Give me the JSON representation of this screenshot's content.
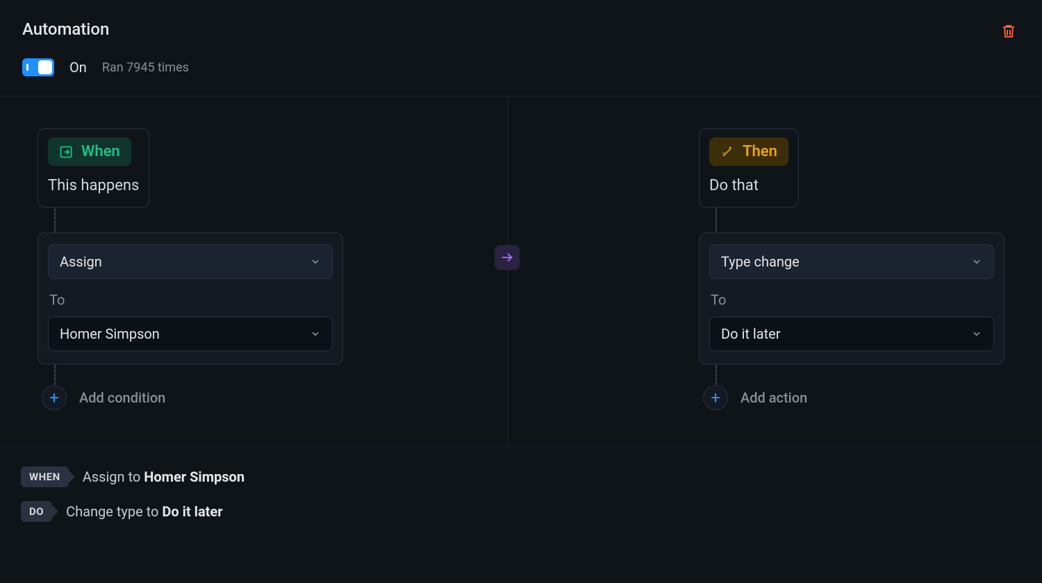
{
  "header": {
    "title": "Automation",
    "toggle_state": "On",
    "run_count_text": "Ran 7945 times"
  },
  "when": {
    "badge": "When",
    "subtitle": "This happens",
    "event_select": "Assign",
    "to_label": "To",
    "to_value": "Homer Simpson",
    "add_label": "Add condition"
  },
  "then": {
    "badge": "Then",
    "subtitle": "Do that",
    "action_select": "Type change",
    "to_label": "To",
    "to_value": "Do it later",
    "add_label": "Add action"
  },
  "summary": {
    "when_tag": "WHEN",
    "when_prefix": "Assign to ",
    "when_bold": "Homer Simpson",
    "do_tag": "DO",
    "do_prefix": "Change type to ",
    "do_bold": "Do it later"
  }
}
